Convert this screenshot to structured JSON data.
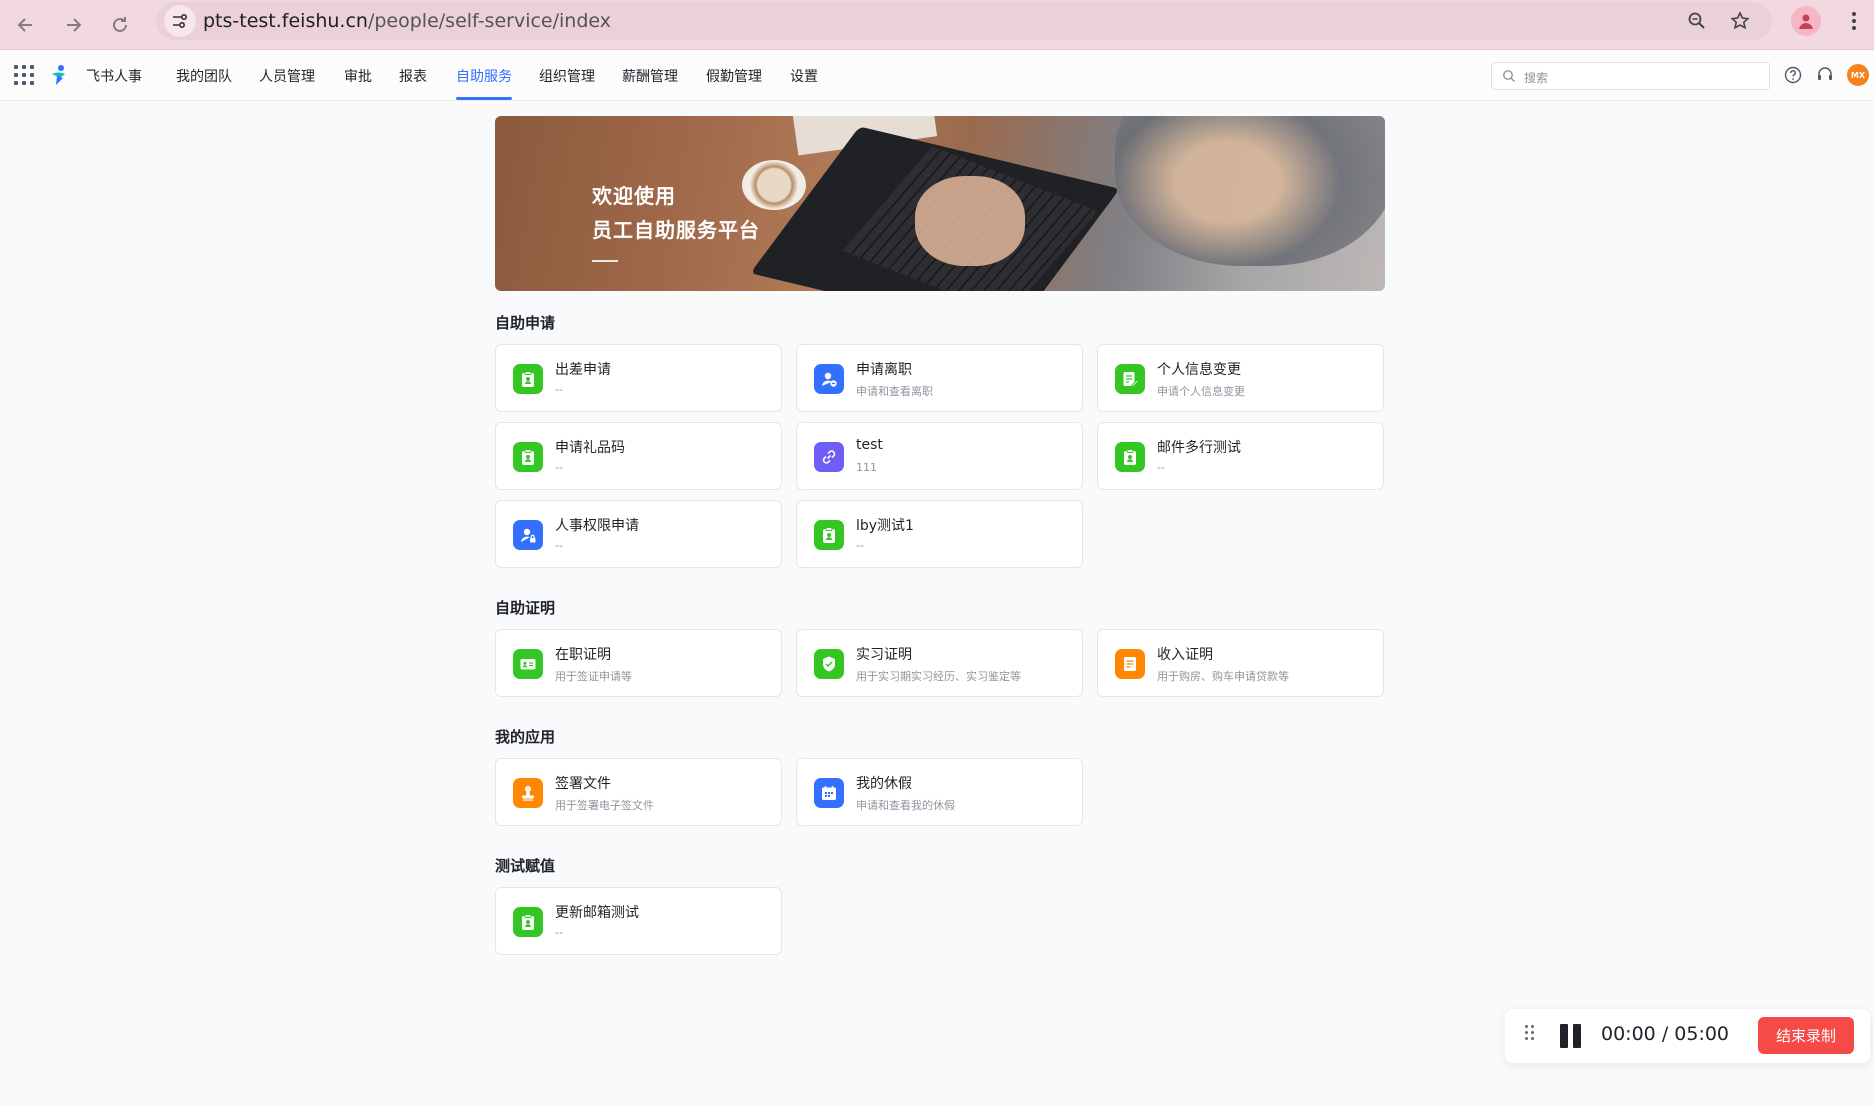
{
  "browser": {
    "url_host": "pts-test.feishu.cn",
    "url_path": "/people/self-service/index"
  },
  "header": {
    "app_name": "飞书人事",
    "nav": [
      "我的团队",
      "人员管理",
      "审批",
      "报表",
      "自助服务",
      "组织管理",
      "薪酬管理",
      "假勤管理",
      "设置"
    ],
    "active_nav": "自助服务",
    "search_placeholder": "搜索",
    "avatar_initials": "MX"
  },
  "banner": {
    "line1": "欢迎使用",
    "line2": "员工自助服务平台"
  },
  "sections": [
    {
      "title": "自助申请",
      "cards": [
        {
          "title": "出差申请",
          "desc": "--",
          "icon": "clipboard-user-icon",
          "color": "#34c724"
        },
        {
          "title": "申请离职",
          "desc": "申请和查看离职",
          "icon": "user-minus-icon",
          "color": "#3370ff"
        },
        {
          "title": "个人信息变更",
          "desc": "申请个人信息变更",
          "icon": "doc-edit-icon",
          "color": "#34c724"
        },
        {
          "title": "申请礼品码",
          "desc": "--",
          "icon": "clipboard-user-icon",
          "color": "#34c724"
        },
        {
          "title": "test",
          "desc": "111",
          "icon": "link-icon",
          "color": "#6f5ef6"
        },
        {
          "title": "邮件多行测试",
          "desc": "--",
          "icon": "clipboard-user-icon",
          "color": "#34c724"
        },
        {
          "title": "人事权限申请",
          "desc": "--",
          "icon": "user-lock-icon",
          "color": "#3370ff"
        },
        {
          "title": "lby测试1",
          "desc": "--",
          "icon": "clipboard-user-icon",
          "color": "#34c724"
        }
      ]
    },
    {
      "title": "自助证明",
      "cards": [
        {
          "title": "在职证明",
          "desc": "用于签证申请等",
          "icon": "id-card-icon",
          "color": "#34c724"
        },
        {
          "title": "实习证明",
          "desc": "用于实习期实习经历、实习鉴定等",
          "icon": "certificate-icon",
          "color": "#34c724"
        },
        {
          "title": "收入证明",
          "desc": "用于购房、购车申请贷款等",
          "icon": "receipt-icon",
          "color": "#ff8800"
        }
      ]
    },
    {
      "title": "我的应用",
      "cards": [
        {
          "title": "签署文件",
          "desc": "用于签署电子签文件",
          "icon": "stamp-icon",
          "color": "#ff8800"
        },
        {
          "title": "我的休假",
          "desc": "申请和查看我的休假",
          "icon": "calendar-icon",
          "color": "#3370ff"
        }
      ]
    },
    {
      "title": "测试赋值",
      "cards": [
        {
          "title": "更新邮箱测试",
          "desc": "--",
          "icon": "clipboard-user-icon",
          "color": "#34c724"
        }
      ]
    }
  ],
  "recorder": {
    "elapsed": "00:00",
    "separator": "/",
    "limit": "05:00",
    "stop_label": "结束录制"
  }
}
